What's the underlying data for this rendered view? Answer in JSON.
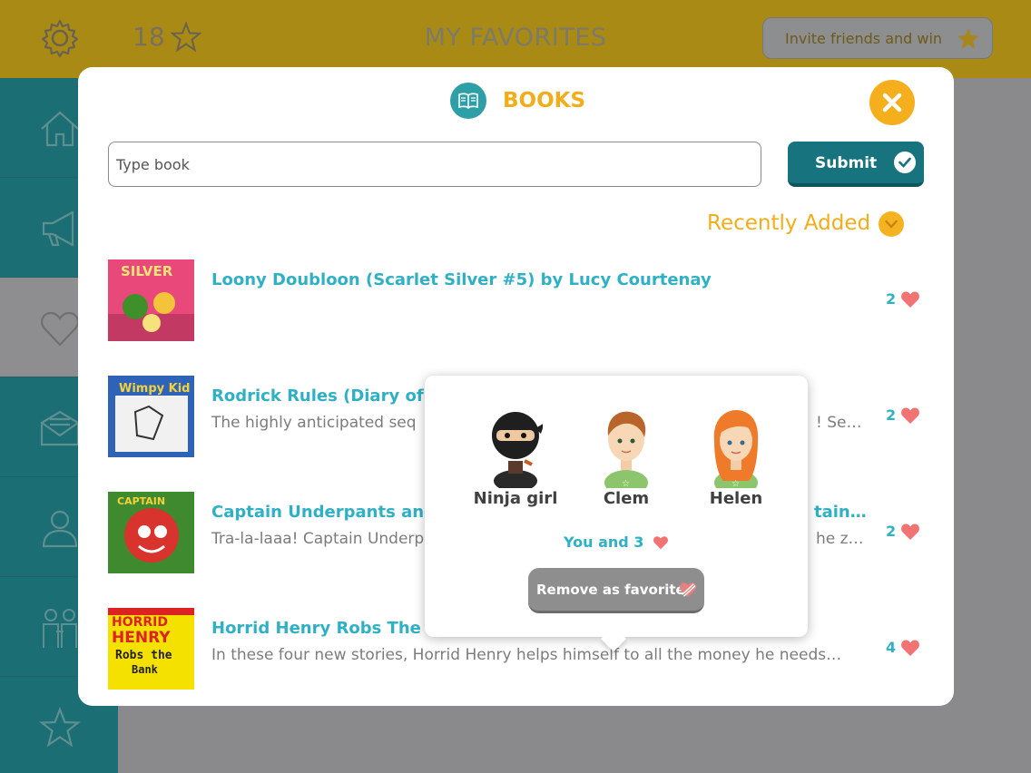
{
  "header": {
    "title": "MY FAVORITES",
    "star_count": "18",
    "invite_label": "Invite friends and win",
    "icons": [
      "gear-icon",
      "star-icon"
    ]
  },
  "sidebar": {
    "items": [
      {
        "icon": "home-icon"
      },
      {
        "icon": "megaphone-icon"
      },
      {
        "icon": "heart-icon",
        "active": true
      },
      {
        "icon": "mail-icon"
      },
      {
        "icon": "profile-icon"
      },
      {
        "icon": "friends-icon"
      },
      {
        "icon": "star-icon"
      }
    ]
  },
  "modal": {
    "title": "BOOKS",
    "icon": "book-icon",
    "input_placeholder": "Type book",
    "submit_label": "Submit",
    "sort_label": "Recently Added",
    "books": [
      {
        "title": "Loony Doubloon (Scarlet Silver #5) by Lucy Courtenay",
        "description": "",
        "likes": "2",
        "cover_text": "SILVER"
      },
      {
        "title": "Rodrick Rules (Diary of a W",
        "description": "The highly anticipated seq",
        "desc_tail": "! Se…",
        "likes": "2",
        "cover_text": "Wimpy Kid"
      },
      {
        "title": "Captain Underpants and th",
        "title_tail": "tain…",
        "description": "Tra-la-laaa! Captain Underp",
        "desc_tail": "he z…",
        "likes": "2",
        "cover_text": "CAPTAIN"
      },
      {
        "title": "Horrid Henry Robs The Ba",
        "description": "In these four new stories, Horrid Henry helps himself to all the money he needs…",
        "likes": "4",
        "cover_text": "HORRID HENRY Robs the Bank"
      }
    ]
  },
  "popover": {
    "friends": [
      {
        "name": "Ninja girl"
      },
      {
        "name": "Clem"
      },
      {
        "name": "Helen"
      }
    ],
    "summary": "You and 3",
    "remove_label": "Remove as favorite"
  },
  "colors": {
    "accent_orange": "#f2ad1a",
    "teal": "#17737e",
    "link_blue": "#2fb0c5",
    "heart_red": "#f27372"
  }
}
